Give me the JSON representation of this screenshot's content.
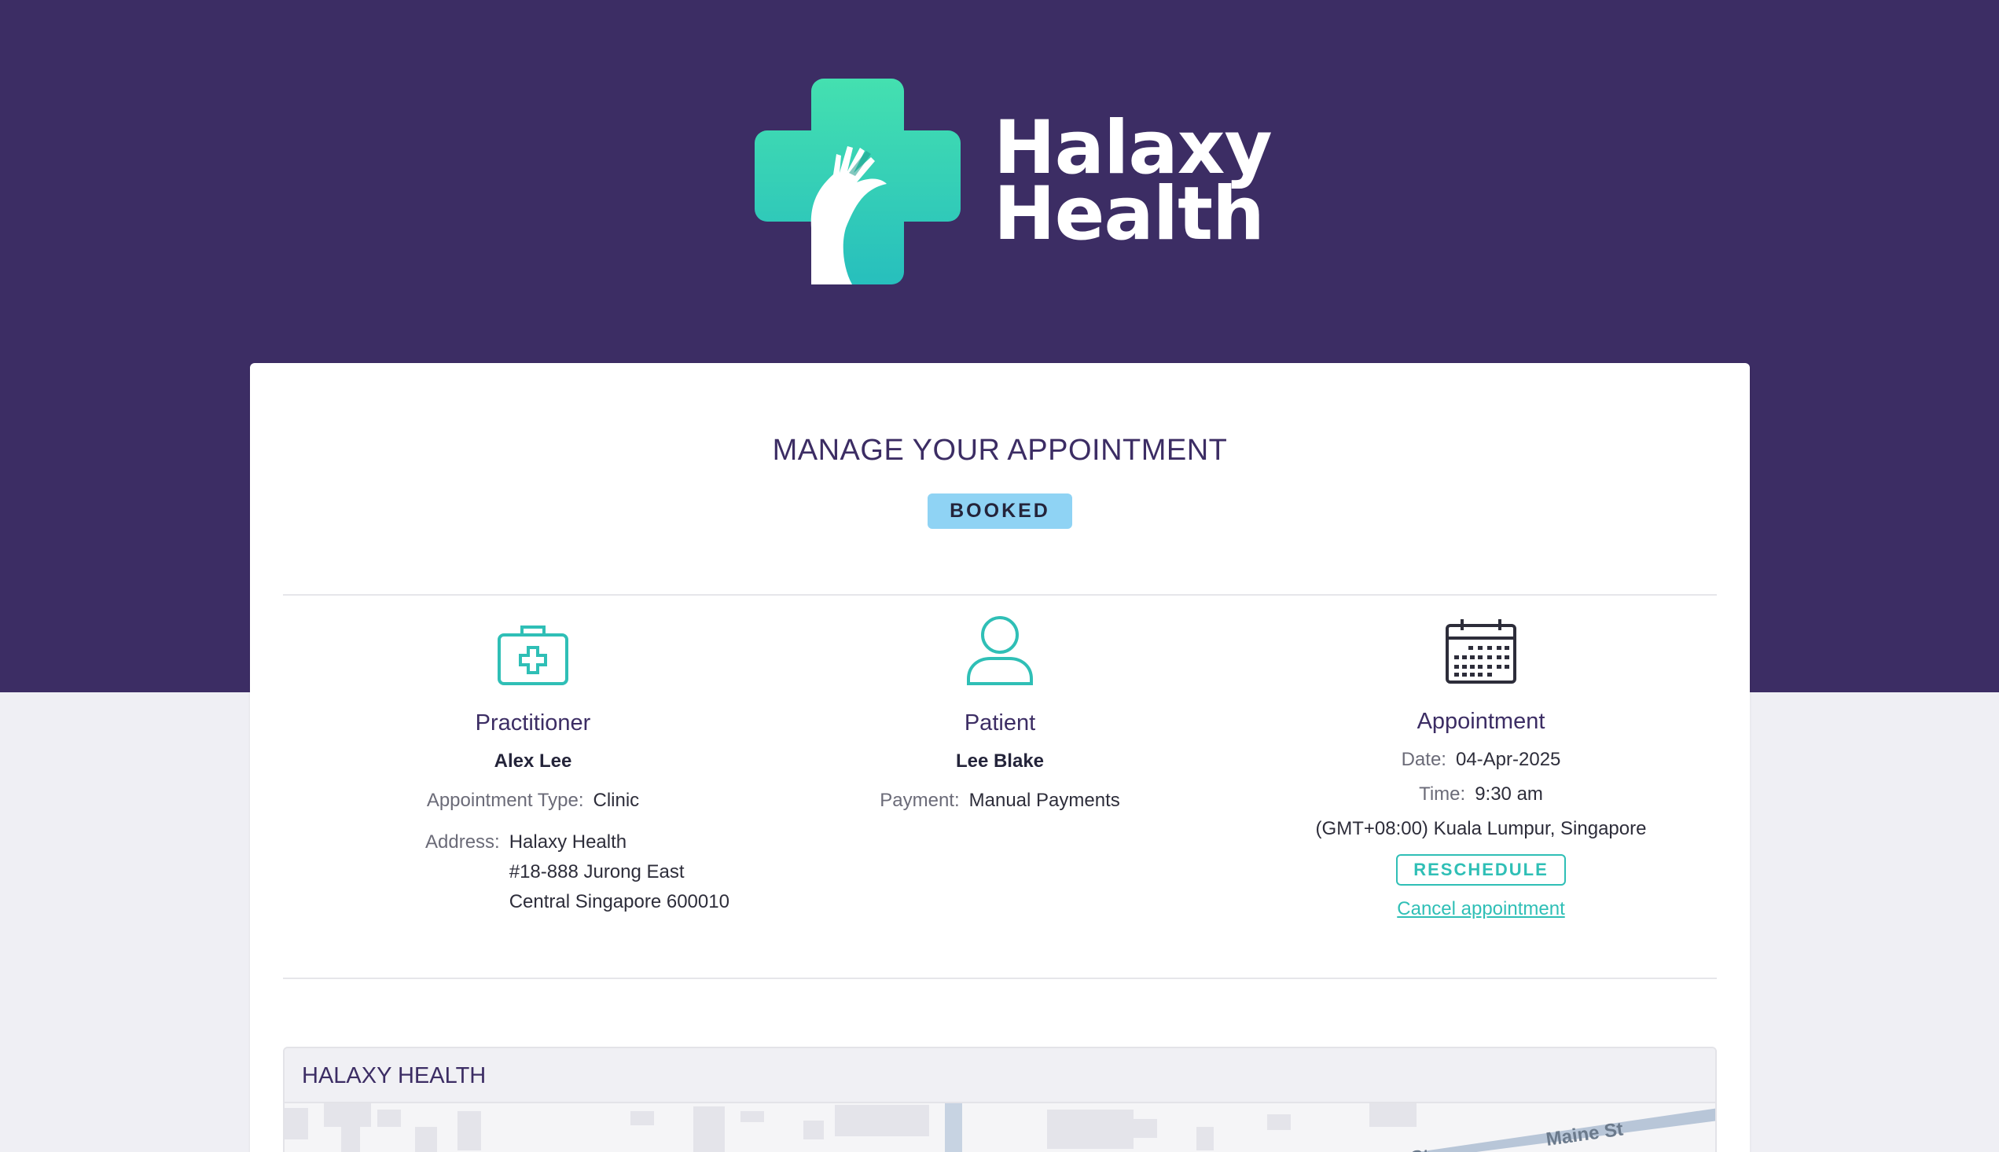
{
  "brand": {
    "name_line1": "Halaxy",
    "name_line2": "Health",
    "colors": {
      "header_bg": "#3c2d64",
      "accent": "#2fbfb6",
      "badge_bg": "#8fd3f4"
    },
    "logo_icon": "medical-cross-hand-icon"
  },
  "page": {
    "title": "MANAGE YOUR APPOINTMENT",
    "status": "BOOKED"
  },
  "practitioner": {
    "heading": "Practitioner",
    "icon": "medical-kit-icon",
    "name": "Alex Lee",
    "type_label": "Appointment Type:",
    "type_value": "Clinic",
    "address_label": "Address:",
    "address_lines": [
      "Halaxy Health",
      "#18-888 Jurong East",
      "Central Singapore 600010"
    ]
  },
  "patient": {
    "heading": "Patient",
    "icon": "user-icon",
    "name": "Lee Blake",
    "payment_label": "Payment:",
    "payment_value": "Manual Payments"
  },
  "appointment": {
    "heading": "Appointment",
    "icon": "calendar-icon",
    "date_label": "Date:",
    "date_value": "04-Apr-2025",
    "time_label": "Time:",
    "time_value": "9:30 am",
    "timezone": "(GMT+08:00) Kuala Lumpur, Singapore",
    "reschedule_label": "RESCHEDULE",
    "cancel_label": "Cancel appointment"
  },
  "location": {
    "heading": "HALAXY HEALTH",
    "street_label_1": "Maine St",
    "street_label_2": "Maine St"
  }
}
